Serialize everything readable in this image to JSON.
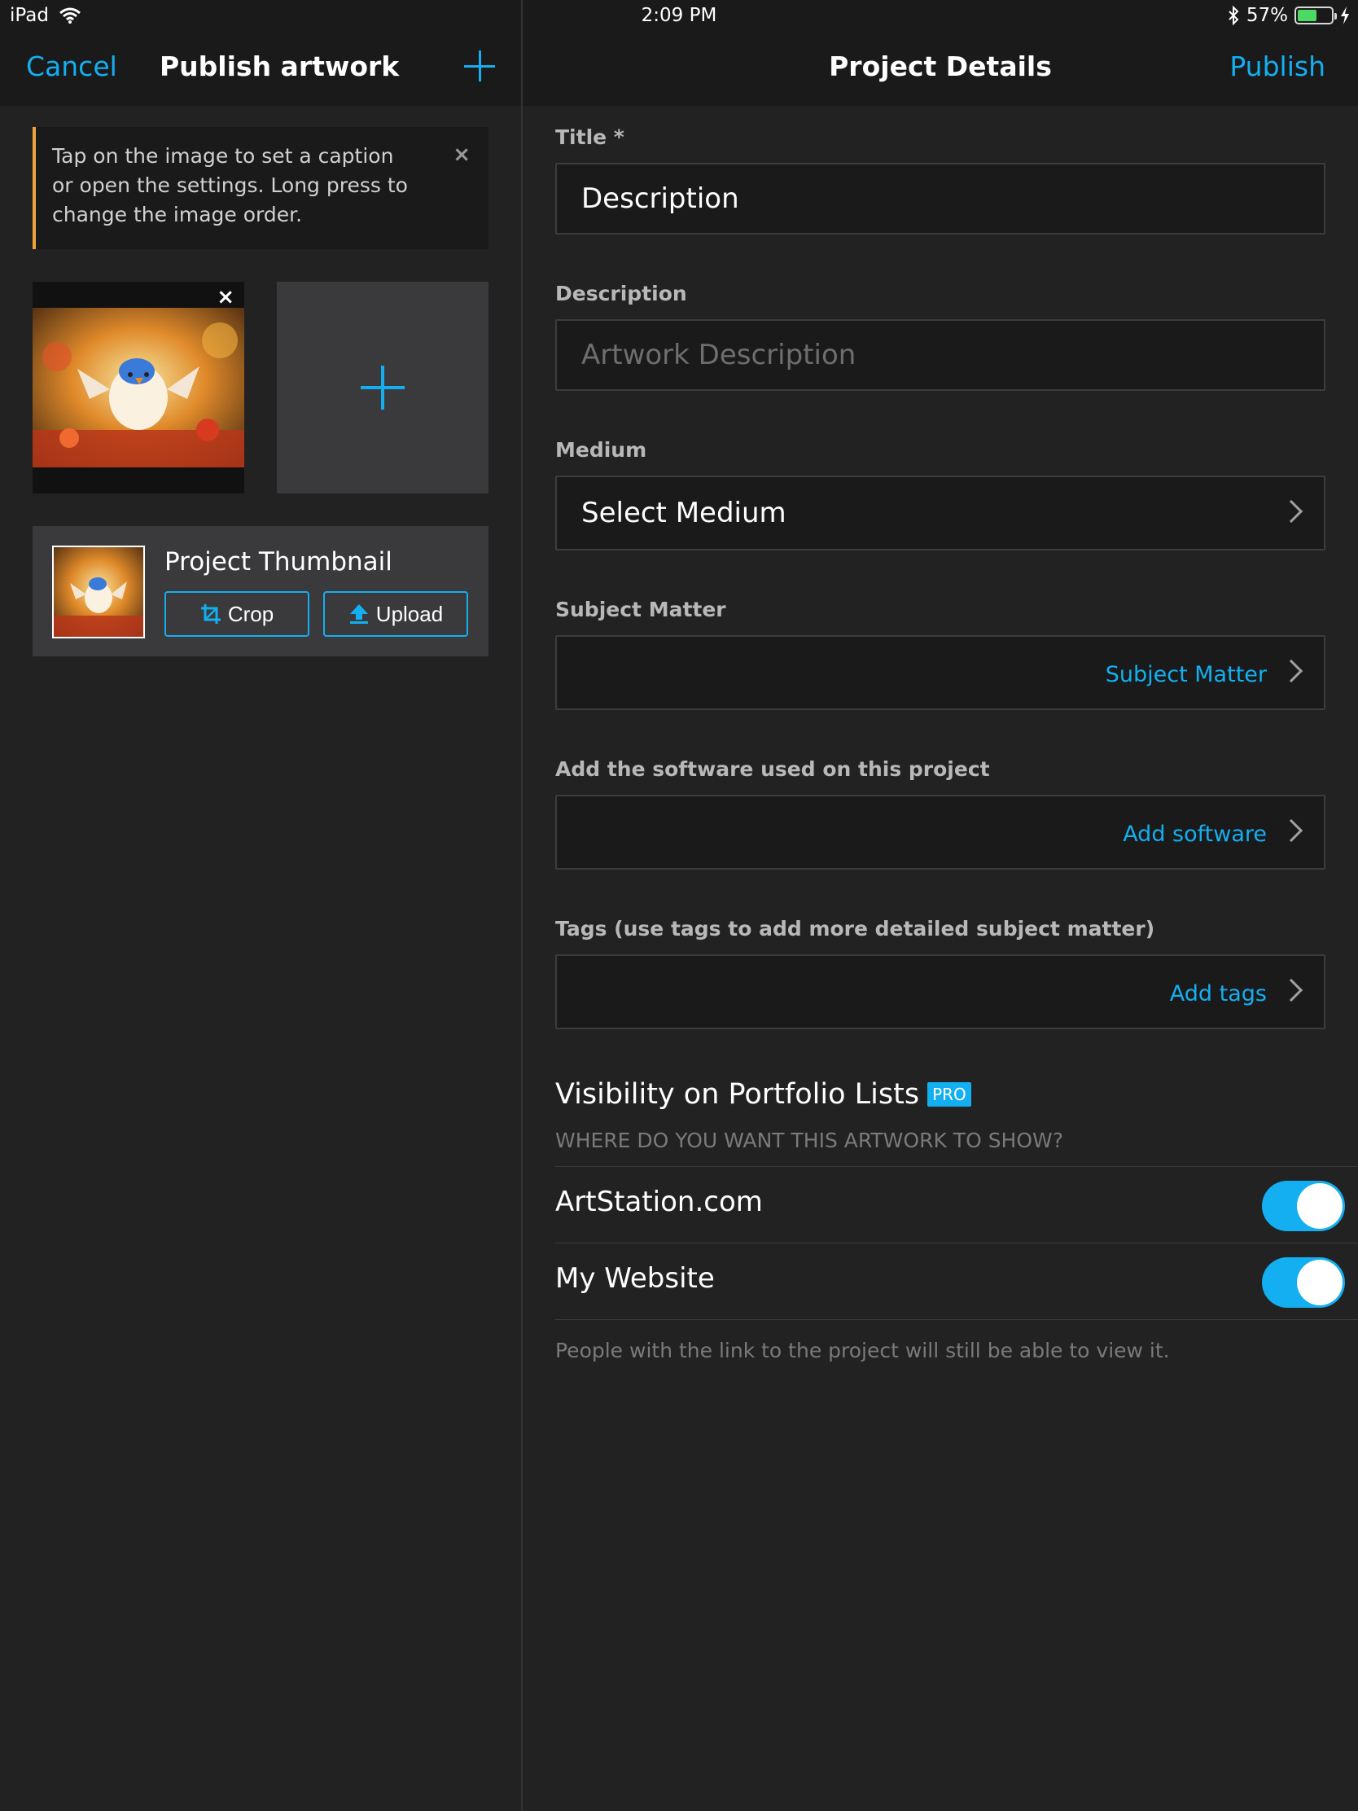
{
  "status_bar": {
    "device": "iPad",
    "time": "2:09 PM",
    "battery": "57%",
    "battery_level": 0.57,
    "battery_color": "#4cd964"
  },
  "left_nav": {
    "cancel": "Cancel",
    "title": "Publish artwork",
    "add_icon": "plus-icon"
  },
  "tip": {
    "text": "Tap on the image to set a caption or open the settings. Long press to change the image order.",
    "close": "×"
  },
  "images": {
    "remove": "×"
  },
  "thumbnail": {
    "title": "Project Thumbnail",
    "crop": "Crop",
    "upload": "Upload"
  },
  "right_nav": {
    "title": "Project Details",
    "publish": "Publish"
  },
  "form": {
    "title_label": "Title *",
    "title_value": "Description",
    "description_label": "Description",
    "description_placeholder": "Artwork Description",
    "medium_label": "Medium",
    "medium_value": "Select Medium",
    "subject_label": "Subject Matter",
    "subject_link": "Subject Matter",
    "software_label": "Add the software used on this project",
    "software_link": "Add software",
    "tags_label": "Tags (use tags to add more detailed subject matter)",
    "tags_link": "Add tags"
  },
  "visibility": {
    "title": "Visibility on Portfolio Lists",
    "badge": "PRO",
    "subtitle": "WHERE DO YOU WANT THIS ARTWORK TO SHOW?",
    "options": [
      {
        "label": "ArtStation.com",
        "on": true
      },
      {
        "label": "My Website",
        "on": true
      }
    ],
    "note": "People with the link to the project will still be able to view it."
  },
  "colors": {
    "accent": "#13aff0",
    "warning": "#f0a33a",
    "background": "#222223"
  }
}
